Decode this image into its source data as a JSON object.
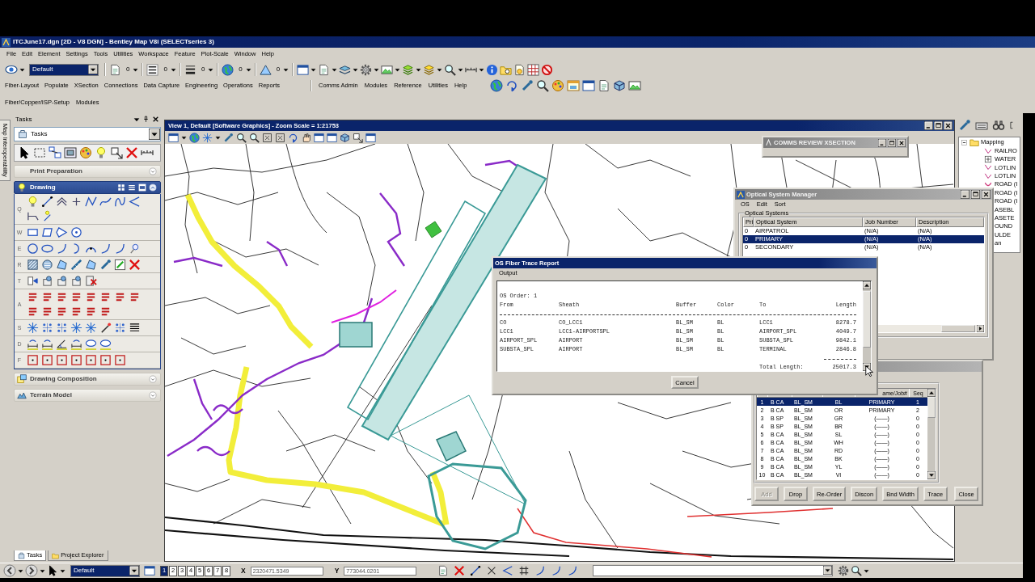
{
  "window": {
    "title": "ITCJune17.dgn [2D - V8 DGN] - Bentley Map V8i (SELECTseries 3)"
  },
  "menu_bar": [
    "File",
    "Edit",
    "Element",
    "Settings",
    "Tools",
    "Utilities",
    "Workspace",
    "Feature",
    "Plot-Scale",
    "Window",
    "Help"
  ],
  "toolbar": {
    "active_level": "Default",
    "counters": [
      "0",
      "0",
      "0",
      "0",
      "0"
    ]
  },
  "app_menu": {
    "left": [
      "Fiber-Layout",
      "Populate",
      "XSection",
      "Connections",
      "Data Capture",
      "Engineering",
      "Operations",
      "Reports"
    ],
    "right": [
      "Comms Admin",
      "Modules",
      "Reference",
      "Utilities",
      "Help"
    ]
  },
  "setup_menu": [
    "Fiber/Copper/ISP-Setup",
    "Modules"
  ],
  "side_tab": {
    "label": "Map Interoperability"
  },
  "tasks_panel": {
    "title": "Tasks",
    "task_dropdown": "Tasks",
    "sections": [
      {
        "label": "Print Preparation",
        "expanded": false
      },
      {
        "label": "Drawing",
        "expanded": true,
        "tool_rows": [
          "Q",
          "W",
          "E",
          "R",
          "T",
          "A",
          "S",
          "D",
          "F"
        ]
      },
      {
        "label": "Drawing Composition",
        "expanded": false
      },
      {
        "label": "Terrain Model",
        "expanded": false
      }
    ],
    "tabs": [
      {
        "label": "Tasks",
        "selected": true
      },
      {
        "label": "Project Explorer",
        "selected": false
      }
    ]
  },
  "view": {
    "title": "View 1, Default [Software Graphics] - Zoom Scale = 1:21753"
  },
  "explorer_tree": {
    "label": "Mapping",
    "expanded": true,
    "children": [
      {
        "label": "RAILRO"
      },
      {
        "label": "WATER"
      },
      {
        "label": "LOTLIN"
      },
      {
        "label": "LOTLIN"
      },
      {
        "label": "ROAD (I"
      },
      {
        "label": "ROAD (I"
      },
      {
        "label": "ROAD (I"
      },
      {
        "label": "ASEBL"
      },
      {
        "label": "ASETE"
      },
      {
        "label": "OUND"
      },
      {
        "label": "ULDE"
      },
      {
        "label": "an"
      }
    ]
  },
  "comms_window": {
    "title": "COMMS REVIEW XSECTION"
  },
  "optical_system_manager": {
    "title": "Optical System Manager",
    "menu": [
      "OS",
      "Edit",
      "Sort"
    ],
    "group_label": "Optical Systems",
    "columns": [
      "Pri",
      "Optical System",
      "Job Number",
      "Description"
    ],
    "rows": [
      {
        "cells": [
          "0",
          "AIRPATROL",
          "(N/A)",
          "(N/A)"
        ],
        "selected": false
      },
      {
        "cells": [
          "0",
          "PRIMARY",
          "(N/A)",
          "(N/A)"
        ],
        "selected": true
      },
      {
        "cells": [
          "0",
          "SECONDARY",
          "(N/A)",
          "(N/A)"
        ],
        "selected": false
      }
    ]
  },
  "trace_report": {
    "title": "OS Fiber Trace Report",
    "menu": [
      "Output"
    ],
    "order_label": "OS Order: 1",
    "columns": [
      "From",
      "Sheath",
      "Buffer",
      "Color",
      "To",
      "Length"
    ],
    "rows": [
      [
        "CO",
        "CO_LCC1",
        "BL_SM",
        "BL",
        "LCC1",
        "8278.7"
      ],
      [
        "LCC1",
        "LCC1-AIRPORTSPL",
        "BL_SM",
        "BL",
        "AIRPORT_SPL",
        "4049.7"
      ],
      [
        "AIRPORT_SPL",
        "AIRPORT",
        "BL_SM",
        "BL",
        "SUBSTA_SPL",
        "9842.1"
      ],
      [
        "SUBSTA_SPL",
        "AIRPORT",
        "BL_SM",
        "BL",
        "TERMINAL",
        "2846.8"
      ]
    ],
    "total_label": "Total Length:",
    "total": "25017.3",
    "button": "Cancel"
  },
  "fiber_list": {
    "columns": [
      "",
      "",
      "",
      "",
      "ame/Job#",
      "Seq"
    ],
    "rows": [
      {
        "cells": [
          "1",
          "B CA",
          "BL_SM",
          "BL",
          "PRIMARY",
          "1"
        ],
        "selected": true
      },
      {
        "cells": [
          "2",
          "B CA",
          "BL_SM",
          "OR",
          "PRIMARY",
          "2"
        ],
        "selected": false
      },
      {
        "cells": [
          "3",
          "B SP",
          "BL_SM",
          "GR",
          "(——)",
          "0"
        ],
        "selected": false
      },
      {
        "cells": [
          "4",
          "B SP",
          "BL_SM",
          "BR",
          "(——)",
          "0"
        ],
        "selected": false
      },
      {
        "cells": [
          "5",
          "B CA",
          "BL_SM",
          "SL",
          "(——)",
          "0"
        ],
        "selected": false
      },
      {
        "cells": [
          "6",
          "B CA",
          "BL_SM",
          "WH",
          "(——)",
          "0"
        ],
        "selected": false
      },
      {
        "cells": [
          "7",
          "B CA",
          "BL_SM",
          "RD",
          "(——)",
          "0"
        ],
        "selected": false
      },
      {
        "cells": [
          "8",
          "B CA",
          "BL_SM",
          "BK",
          "(——)",
          "0"
        ],
        "selected": false
      },
      {
        "cells": [
          "9",
          "B CA",
          "BL_SM",
          "YL",
          "(——)",
          "0"
        ],
        "selected": false
      },
      {
        "cells": [
          "10",
          "B CA",
          "BL_SM",
          "VI",
          "(——)",
          "0"
        ],
        "selected": false
      }
    ],
    "buttons": [
      {
        "label": "Add",
        "disabled": true
      },
      {
        "label": "Drop",
        "disabled": false
      },
      {
        "label": "Re-Order",
        "disabled": false
      },
      {
        "label": "Discon",
        "disabled": false
      },
      {
        "label": "Bnd Width",
        "disabled": false
      },
      {
        "label": "Trace",
        "disabled": false
      },
      {
        "label": "Close",
        "disabled": false
      }
    ]
  },
  "status_bar": {
    "active_level": "Default",
    "views": [
      {
        "label": "1",
        "selected": true
      },
      {
        "label": "2",
        "selected": false
      },
      {
        "label": "3",
        "selected": false
      },
      {
        "label": "4",
        "selected": false
      },
      {
        "label": "5",
        "selected": false
      },
      {
        "label": "6",
        "selected": false
      },
      {
        "label": "7",
        "selected": false
      },
      {
        "label": "8",
        "selected": false
      }
    ],
    "x_label": "X",
    "x_value": "2320471.5349",
    "y_label": "Y",
    "y_value": "773044.0201"
  }
}
